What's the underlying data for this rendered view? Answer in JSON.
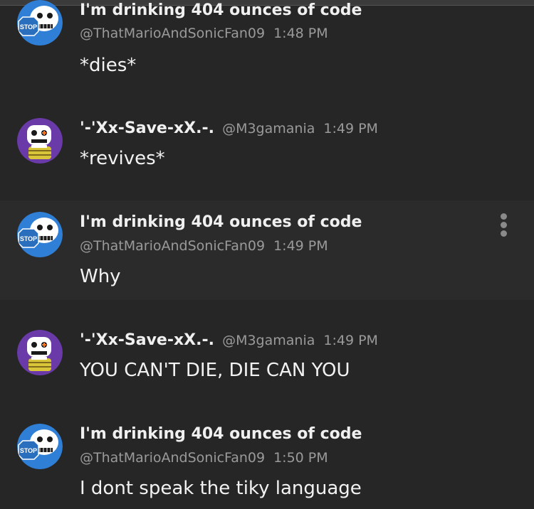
{
  "messages": [
    {
      "author": "I'm drinking 404 ounces of code",
      "handle": "@ThatMarioAndSonicFan09",
      "time": "1:48 PM",
      "text": "*dies*",
      "avatar": "skull-stop-sign-avatar"
    },
    {
      "author": "'-'Xx-Save-xX.-.",
      "handle": "@M3gamania",
      "time": "1:49 PM",
      "text": "*revives*",
      "avatar": "purple-skeleton-avatar"
    },
    {
      "author": "I'm drinking 404 ounces of code",
      "handle": "@ThatMarioAndSonicFan09",
      "time": "1:49 PM",
      "text": "Why",
      "avatar": "skull-stop-sign-avatar"
    },
    {
      "author": "'-'Xx-Save-xX.-.",
      "handle": "@M3gamania",
      "time": "1:49 PM",
      "text": "YOU CAN'T DIE, DIE CAN YOU",
      "avatar": "purple-skeleton-avatar"
    },
    {
      "author": "I'm drinking 404 ounces of code",
      "handle": "@ThatMarioAndSonicFan09",
      "time": "1:50 PM",
      "text": "I dont speak the tiky language",
      "avatar": "skull-stop-sign-avatar"
    }
  ],
  "avatar_stop_text": "STOP",
  "colors": {
    "background": "#262626",
    "hover_background": "#2b2b2b",
    "name": "#f0f0f0",
    "meta": "#9a9a9a",
    "avatar_blue": "#2f7fd6",
    "avatar_purple": "#6a3aa8"
  },
  "icons": {
    "more": "vertical-ellipsis-icon"
  }
}
